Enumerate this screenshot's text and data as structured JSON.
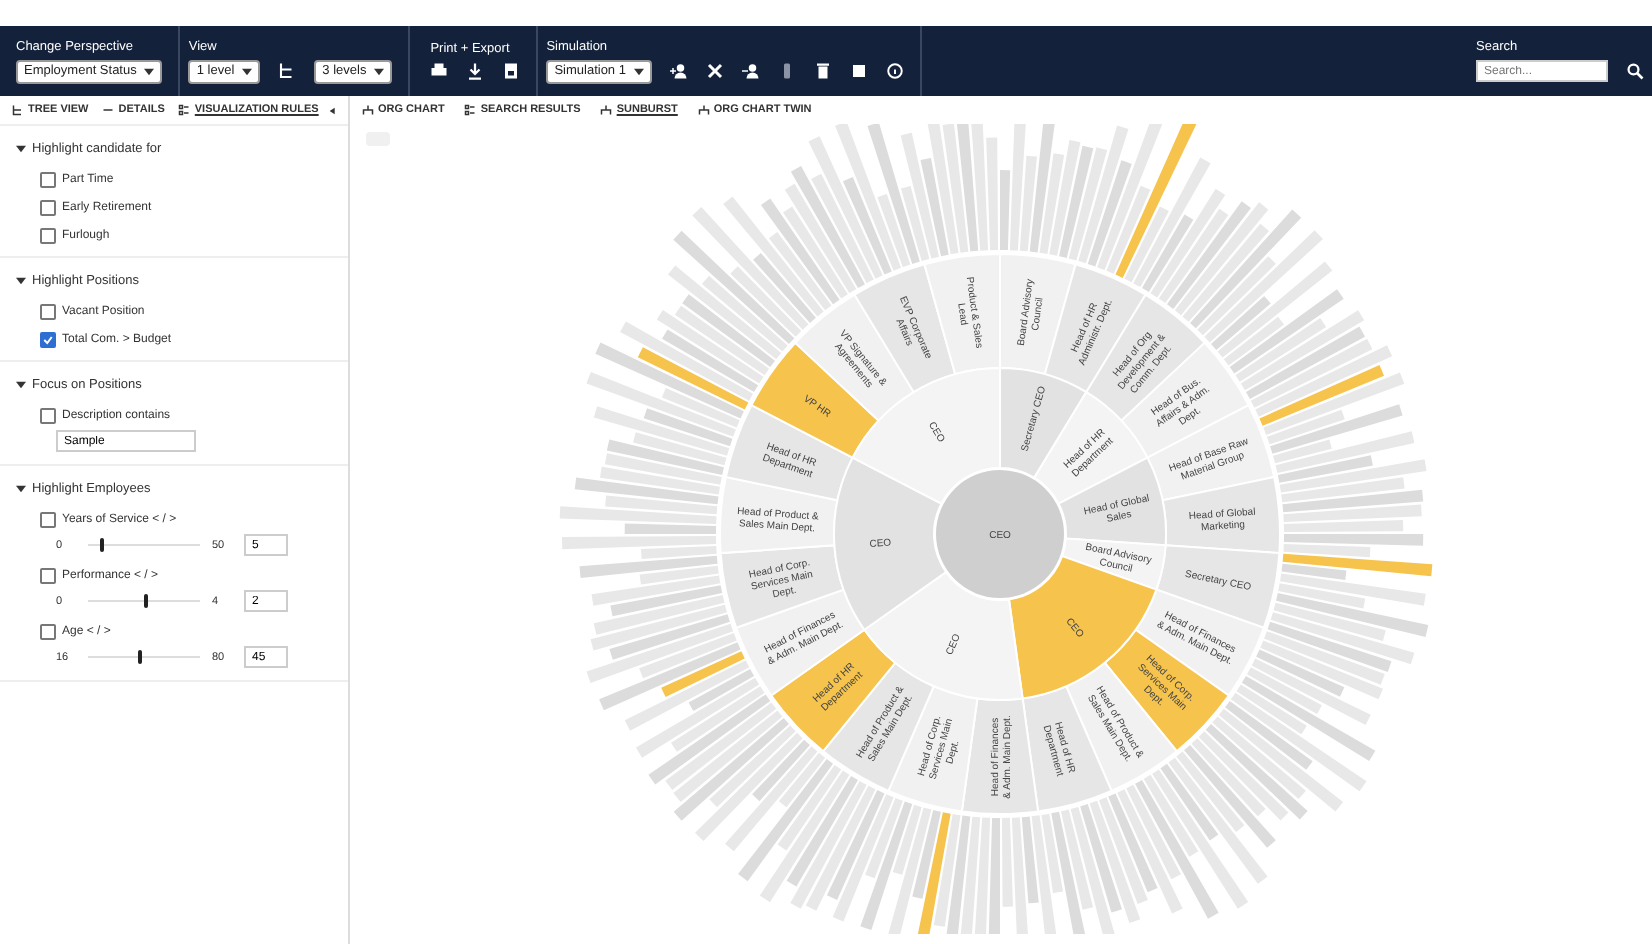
{
  "toolbar": {
    "groups": [
      {
        "label": "Change Perspective",
        "selects": [
          "Employment Status"
        ]
      },
      {
        "label": "View",
        "selects": [
          "1 level",
          "3 levels"
        ]
      },
      {
        "label": "Print + Export"
      },
      {
        "label": "Simulation",
        "selects": [
          "Simulation 1"
        ]
      }
    ],
    "search": {
      "label": "Search",
      "placeholder": "Search..."
    }
  },
  "side_tabs": [
    {
      "label": "TREE VIEW",
      "selected": false
    },
    {
      "label": "DETAILS",
      "selected": false
    },
    {
      "label": "VISUALIZATION RULES",
      "selected": true
    }
  ],
  "sections": [
    {
      "title": "Highlight candidate for",
      "expanded": true,
      "items": [
        {
          "kind": "check",
          "label": "Part Time",
          "checked": false
        },
        {
          "kind": "check",
          "label": "Early Retirement",
          "checked": false
        },
        {
          "kind": "check",
          "label": "Furlough",
          "checked": false
        }
      ]
    },
    {
      "title": "Highlight Positions",
      "expanded": true,
      "items": [
        {
          "kind": "check",
          "label": "Vacant Position",
          "checked": false
        },
        {
          "kind": "check",
          "label": "Total Com. > Budget",
          "checked": true
        }
      ]
    },
    {
      "title": "Focus on Positions",
      "expanded": true,
      "items": [
        {
          "kind": "text",
          "label": "Description contains",
          "checked": false,
          "value": "Sample"
        }
      ]
    },
    {
      "title": "Highlight Employees",
      "expanded": true,
      "items": [
        {
          "kind": "range",
          "label": "Years of Service < / >",
          "checked": false,
          "min": "0",
          "max": "50",
          "level": 0.1,
          "value": "5"
        },
        {
          "kind": "range",
          "label": "Performance < / >",
          "checked": false,
          "min": "0",
          "max": "4",
          "level": 0.5,
          "value": "2"
        },
        {
          "kind": "range",
          "label": "Age < / >",
          "checked": false,
          "min": "16",
          "max": "80",
          "level": 0.45,
          "value": "45"
        }
      ]
    }
  ],
  "chart_tabs": [
    {
      "label": "ORG CHART",
      "selected": false
    },
    {
      "label": "SEARCH RESULTS",
      "selected": false
    },
    {
      "label": "SUNBURST",
      "selected": true
    },
    {
      "label": "ORG CHART TWIN",
      "selected": false
    }
  ],
  "sunburst": {
    "center": "CEO",
    "ring": [
      {
        "label": "Secretary CEO",
        "highlighted": false,
        "children": [
          {
            "label": "Board Advisory Council",
            "highlighted": false
          },
          {
            "label": "Head of HR Administr. Dept.",
            "highlighted": false
          }
        ]
      },
      {
        "label": "Head of HR Department",
        "highlighted": false,
        "children": [
          {
            "label": "Head of Org Development & Comm. Dept.",
            "highlighted": false
          },
          {
            "label": "Head of Bus. Affairs & Adm. Dept.",
            "highlighted": false
          }
        ]
      },
      {
        "label": "Head of Global Sales",
        "highlighted": false,
        "children": [
          {
            "label": "Head of Base Raw Material Group",
            "highlighted": false
          },
          {
            "label": "Head of Global Marketing",
            "highlighted": false
          }
        ]
      },
      {
        "label": "Board Advisory Council",
        "highlighted": false,
        "children": [
          {
            "label": "Secretary CEO",
            "highlighted": false
          }
        ]
      },
      {
        "label": "CEO",
        "highlighted": true,
        "children": [
          {
            "label": "Head of Finances & Adm. Main Dept.",
            "highlighted": false
          },
          {
            "label": "Head of Corp. Services Main Dept.",
            "highlighted": true
          },
          {
            "label": "Head of Product & Sales Main Dept.",
            "highlighted": false
          },
          {
            "label": "Head of HR Department",
            "highlighted": false
          }
        ]
      },
      {
        "label": "CEO",
        "highlighted": false,
        "children": [
          {
            "label": "Head of Finances & Adm. Main Dept.",
            "highlighted": false
          },
          {
            "label": "Head of Corp. Services Main Dept.",
            "highlighted": false
          },
          {
            "label": "Head of Product & Sales Main Dept.",
            "highlighted": false
          },
          {
            "label": "Head of HR Department",
            "highlighted": true
          }
        ]
      },
      {
        "label": "CEO",
        "highlighted": false,
        "children": [
          {
            "label": "Head of Finances & Adm. Main Dept.",
            "highlighted": false
          },
          {
            "label": "Head of Corp. Services Main Dept.",
            "highlighted": false
          },
          {
            "label": "Head of Product & Sales Main Dept.",
            "highlighted": false
          },
          {
            "label": "Head of HR Department",
            "highlighted": false
          }
        ]
      },
      {
        "label": "CEO",
        "highlighted": false,
        "children": [
          {
            "label": "VP HR",
            "highlighted": true
          },
          {
            "label": "VP Signature & Agreements",
            "highlighted": false
          },
          {
            "label": "EVP Corporate Affairs",
            "highlighted": false
          },
          {
            "label": "Product & Sales Lead",
            "highlighted": false
          }
        ]
      }
    ]
  }
}
